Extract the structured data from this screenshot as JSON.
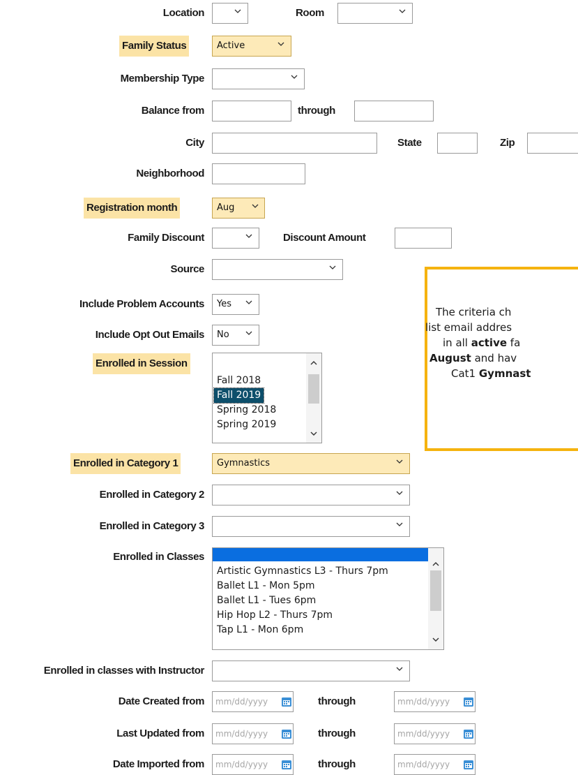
{
  "filters": {
    "location_label": "Location",
    "room_label": "Room",
    "family_status_label": "Family Status",
    "family_status_value": "Active",
    "membership_type_label": "Membership Type",
    "balance_from_label": "Balance from",
    "balance_through_label": "through",
    "city_label": "City",
    "state_label": "State",
    "zip_label": "Zip",
    "neighborhood_label": "Neighborhood",
    "registration_month_label": "Registration month",
    "registration_month_value": "Aug",
    "family_discount_label": "Family Discount",
    "discount_amount_label": "Discount Amount",
    "source_label": "Source",
    "include_problem_accounts_label": "Include Problem Accounts",
    "include_problem_accounts_value": "Yes",
    "include_opt_out_emails_label": "Include Opt Out Emails",
    "include_opt_out_emails_value": "No",
    "enrolled_in_session_label": "Enrolled in Session",
    "session_options": [
      "Fall 2018",
      "Fall 2019",
      "Spring 2018",
      "Spring 2019"
    ],
    "session_selected": "Fall 2019",
    "enrolled_in_category1_label": "Enrolled in Category 1",
    "category1_value": "Gymnastics",
    "enrolled_in_category2_label": "Enrolled in Category 2",
    "enrolled_in_category3_label": "Enrolled in Category 3",
    "enrolled_in_classes_label": "Enrolled in Classes",
    "class_options": [
      "Artistic Gymnastics L3 - Thurs 7pm",
      "Ballet L1 - Mon 5pm",
      "Ballet L1 - Tues 6pm",
      "Hip Hop L2 - Thurs 7pm",
      "Tap L1 - Mon 6pm"
    ],
    "enrolled_with_instructor_label": "Enrolled in classes with Instructor",
    "date_created_from_label": "Date Created from",
    "last_updated_from_label": "Last Updated from",
    "date_imported_from_label": "Date Imported from",
    "date_through_label": "through",
    "date_placeholder": "mm/dd/yyyy"
  },
  "callout": {
    "line1": "The criteria ch",
    "line2": "list email addres",
    "line3_pre": "in all ",
    "line3_bold": "active",
    "line3_post": " fa",
    "line4_bold": "August",
    "line4_post": " and hav",
    "line5_pre": "Cat1 ",
    "line5_bold": "Gymnast"
  },
  "colors": {
    "highlight": "#fbe3a6",
    "selected_option": "#0d4f6b",
    "blue_selection": "#0a6ee0",
    "callout_border": "#f5b30f",
    "calendar_icon": "#3a8fd6"
  }
}
